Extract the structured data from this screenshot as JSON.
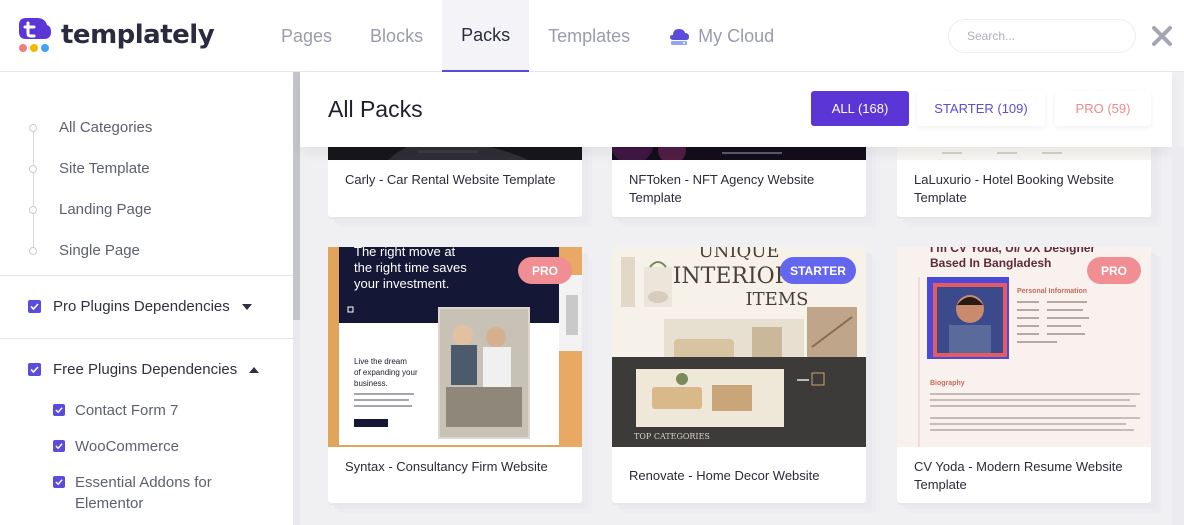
{
  "app": {
    "brand": "templately"
  },
  "nav": {
    "tabs": [
      {
        "label": "Pages"
      },
      {
        "label": "Blocks"
      },
      {
        "label": "Packs"
      },
      {
        "label": "Templates"
      },
      {
        "label": "My Cloud"
      }
    ],
    "active": "Packs"
  },
  "search": {
    "placeholder": "Search...",
    "value": ""
  },
  "sidebar": {
    "categories": [
      {
        "label": "All Categories"
      },
      {
        "label": "Site Template"
      },
      {
        "label": "Landing Page"
      },
      {
        "label": "Single Page"
      }
    ],
    "pro_dependencies": {
      "label": "Pro Plugins Dependencies",
      "checked": true,
      "expanded": false
    },
    "free_dependencies": {
      "label": "Free Plugins Dependencies",
      "checked": true,
      "expanded": true,
      "items": [
        {
          "label": "Contact Form 7",
          "checked": true
        },
        {
          "label": "WooCommerce",
          "checked": true
        },
        {
          "label": "Essential Addons for Elementor",
          "checked": true
        }
      ]
    }
  },
  "main": {
    "title": "All Packs",
    "filters": {
      "all": "ALL (168)",
      "starter": "STARTER (109)",
      "pro": "PRO (59)"
    },
    "cards_top": [
      {
        "title": "Carly - Car Rental Website Template"
      },
      {
        "title": "NFToken - NFT Agency Website Template"
      },
      {
        "title": "LaLuxurio - Hotel Booking Website Template"
      }
    ],
    "cards": [
      {
        "title": "Syntax - Consultancy Firm Website",
        "badge": "PRO",
        "thumb_text": [
          "The right move at",
          "the right time saves",
          "your investment.",
          "Live the dream",
          "of expanding your",
          "business."
        ]
      },
      {
        "title": "Renovate - Home Decor Website",
        "badge": "STARTER",
        "thumb_text": [
          "UNIQUE",
          "INTERIOR",
          "ITEMS",
          "TOP CATEGORIES"
        ]
      },
      {
        "title": "CV Yoda - Modern Resume Website Template",
        "badge": "PRO",
        "thumb_text": [
          "I'm CV Yoda, UI/ UX Designer",
          "Based In Bangladesh",
          "Personal Information",
          "Biography"
        ]
      }
    ]
  },
  "colors": {
    "accent": "#5b35d5",
    "pro": "#f08e93",
    "starter": "#6566f0"
  }
}
